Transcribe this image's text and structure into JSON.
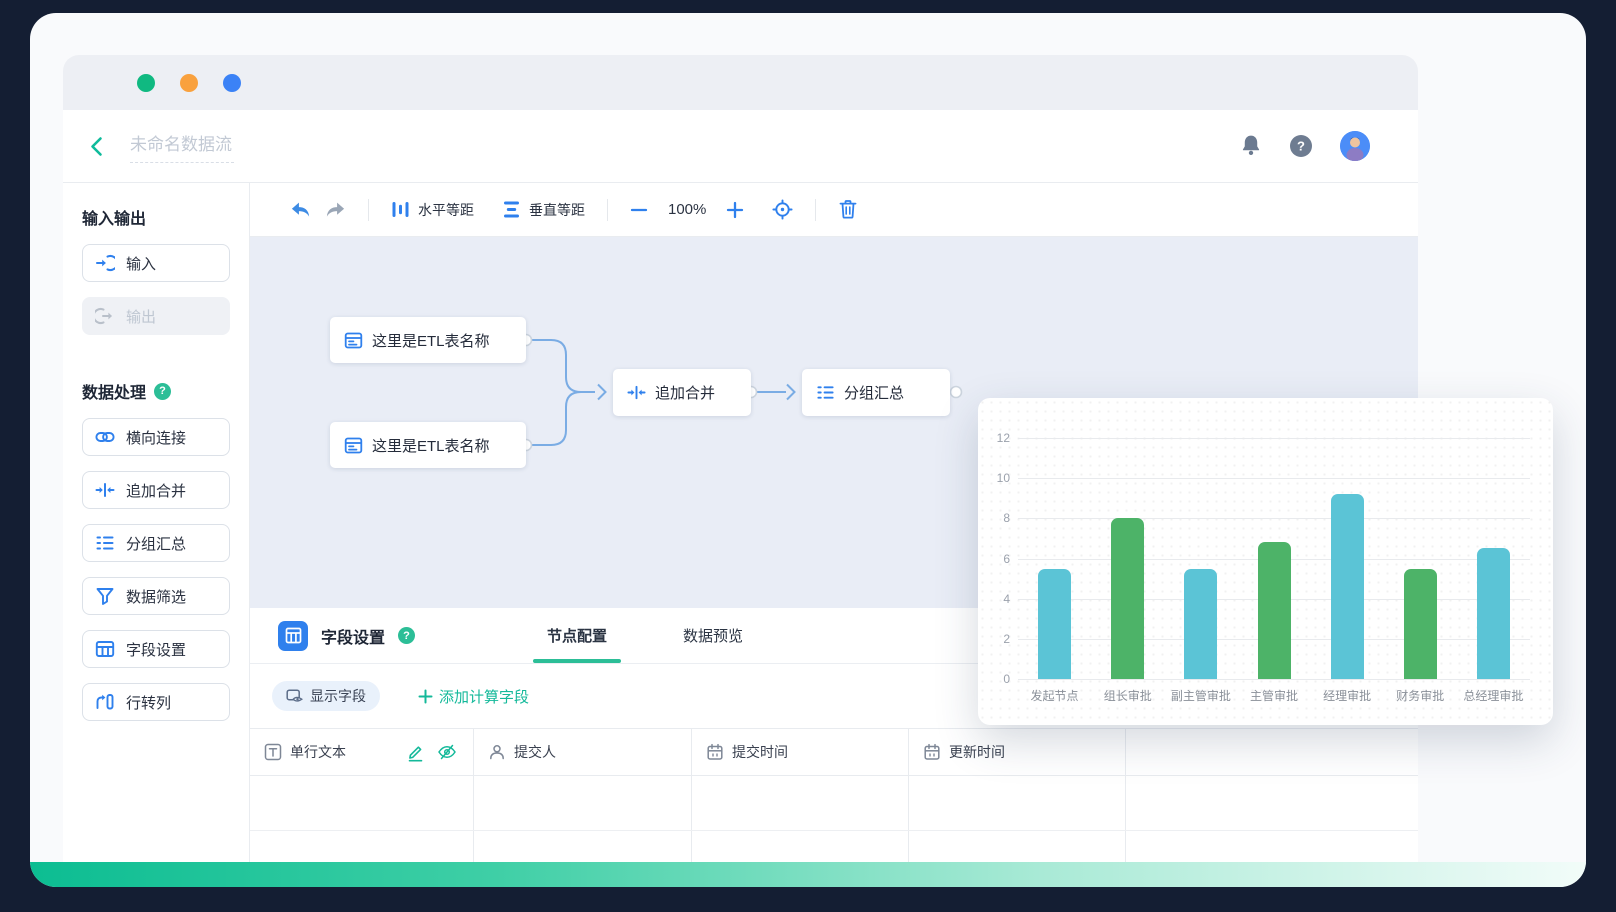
{
  "browser": {
    "traffic_light_colors": [
      "#10B981",
      "#F9A13E",
      "#3B82F6"
    ]
  },
  "header": {
    "title_placeholder": "未命名数据流"
  },
  "sidebar": {
    "io_section_title": "输入输出",
    "input_label": "输入",
    "output_label": "输出",
    "process_section_title": "数据处理",
    "process_items": [
      {
        "label": "横向连接",
        "icon": "link-icon"
      },
      {
        "label": "追加合并",
        "icon": "append-merge-icon"
      },
      {
        "label": "分组汇总",
        "icon": "group-summary-icon"
      },
      {
        "label": "数据筛选",
        "icon": "filter-icon"
      },
      {
        "label": "字段设置",
        "icon": "field-settings-icon"
      },
      {
        "label": "行转列",
        "icon": "row-to-column-icon"
      }
    ]
  },
  "toolbar": {
    "distribute_h_label": "水平等距",
    "distribute_v_label": "垂直等距",
    "zoom_level": "100%"
  },
  "flow": {
    "etl_node_1": "这里是ETL表名称",
    "etl_node_2": "这里是ETL表名称",
    "merge_node": "追加合并",
    "group_node": "分组汇总"
  },
  "panel": {
    "title": "字段设置",
    "tabs": [
      {
        "label": "节点配置",
        "active": true
      },
      {
        "label": "数据预览",
        "active": false
      }
    ],
    "show_fields_label": "显示字段",
    "add_calc_field_label": "添加计算字段"
  },
  "table": {
    "columns": [
      {
        "label": "单行文本",
        "icon": "text-field-icon"
      },
      {
        "label": "提交人",
        "icon": "user-icon"
      },
      {
        "label": "提交时间",
        "icon": "calendar-icon"
      },
      {
        "label": "更新时间",
        "icon": "calendar-icon"
      }
    ]
  },
  "chart_data": {
    "type": "bar",
    "title": "",
    "xlabel": "",
    "ylabel": "",
    "categories": [
      "发起节点",
      "组长审批",
      "副主管审批",
      "主管审批",
      "经理审批",
      "财务审批",
      "总经理审批"
    ],
    "values": [
      5.5,
      8,
      5.5,
      6.8,
      9.2,
      5.5,
      6.5
    ],
    "ylim": [
      0,
      12
    ],
    "ytick_step": 2,
    "grid": true,
    "legend": false,
    "bar_colors": [
      "#5BC4D6",
      "#4DB368"
    ]
  },
  "colors": {
    "accent_blue": "#2F80ED",
    "accent_teal": "#14B99A",
    "canvas_background": "#E9EDF6",
    "frame_navy": "#141E33",
    "teal_gradient_start": "#0CBD92"
  }
}
